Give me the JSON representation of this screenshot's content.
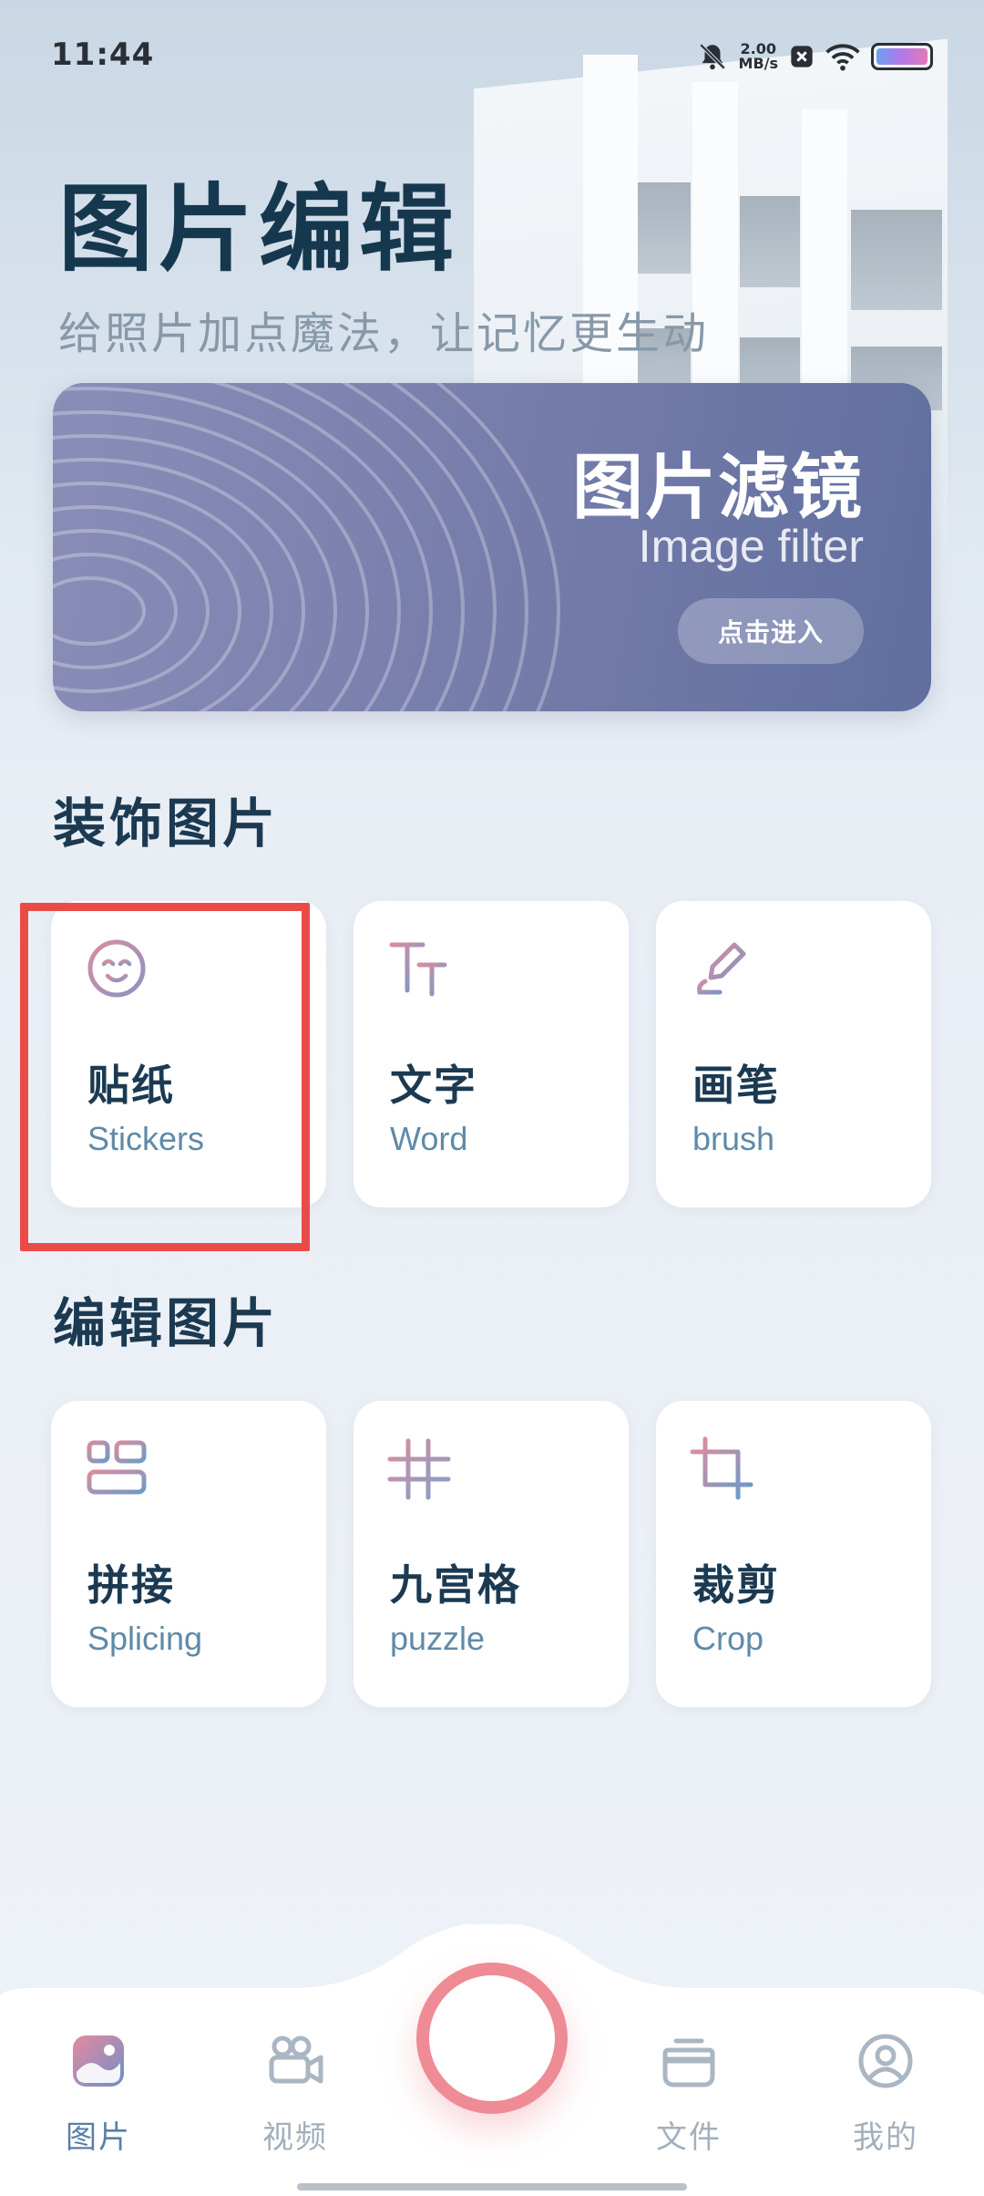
{
  "status_bar": {
    "time": "11:44",
    "net_speed_value": "2.00",
    "net_speed_unit": "MB/s",
    "icons": [
      "bell-off-icon",
      "close-box-icon",
      "wifi-icon",
      "battery-icon"
    ]
  },
  "header": {
    "title": "图片编辑",
    "subtitle": "给照片加点魔法，让记忆更生动"
  },
  "banner": {
    "title": "图片滤镜",
    "subtitle": "Image filter",
    "button_label": "点击进入"
  },
  "sections": [
    {
      "title": "装饰图片",
      "cards": [
        {
          "cn": "贴纸",
          "en": "Stickers",
          "icon": "sticker-smile-icon"
        },
        {
          "cn": "文字",
          "en": "Word",
          "icon": "text-size-icon"
        },
        {
          "cn": "画笔",
          "en": "brush",
          "icon": "brush-icon"
        }
      ]
    },
    {
      "title": "编辑图片",
      "cards": [
        {
          "cn": "拼接",
          "en": "Splicing",
          "icon": "layout-grid-icon"
        },
        {
          "cn": "九宫格",
          "en": "puzzle",
          "icon": "hash-grid-icon"
        },
        {
          "cn": "裁剪",
          "en": "Crop",
          "icon": "crop-icon"
        }
      ]
    }
  ],
  "bottom_nav": {
    "items": [
      {
        "label": "图片",
        "icon": "image-icon",
        "active": true
      },
      {
        "label": "视频",
        "icon": "video-camera-icon",
        "active": false
      },
      {
        "label": "文件",
        "icon": "file-stack-icon",
        "active": false
      },
      {
        "label": "我的",
        "icon": "user-icon",
        "active": false
      }
    ],
    "center_button": "camera-shutter"
  },
  "colors": {
    "accent": "#ef8b95",
    "title": "#16384f",
    "highlight": "#ea4b46",
    "banner": "#7b80ad"
  }
}
